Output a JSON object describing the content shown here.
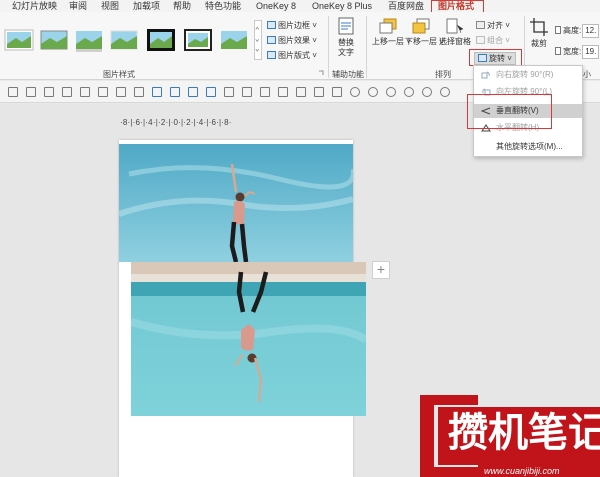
{
  "tabs": [
    "幻灯片放映",
    "审阅",
    "视图",
    "加载项",
    "帮助",
    "特色功能",
    "OneKey 8",
    "OneKey 8 Plus",
    "百度网盘",
    "图片格式"
  ],
  "active_tab": "图片格式",
  "ribbon": {
    "picture_styles_label": "图片样式",
    "picture_border": "图片边框",
    "picture_effects": "图片效果",
    "picture_layout": "图片版式",
    "alt_text": "替换\n文字",
    "accessibility_label": "辅助功能",
    "bring_forward": "上移一层",
    "send_backward": "下移一层",
    "selection_pane": "选择窗格",
    "align": "对齐",
    "group": "组合",
    "rotate": "旋转",
    "arrange_label": "排列",
    "crop": "裁剪",
    "height_label": "高度:",
    "height_value": "12.",
    "width_label": "宽度:",
    "width_value": "19.",
    "size_label_fragment": "小"
  },
  "rotate_menu": {
    "items": [
      {
        "label": "向右旋转 90°(R)",
        "enabled": false
      },
      {
        "label": "向左旋转 90°(L)",
        "enabled": false
      },
      {
        "label": "垂直翻转(V)",
        "enabled": true,
        "highlighted": true
      },
      {
        "label": "水平翻转(H)",
        "enabled": false
      },
      {
        "label": "其他旋转选项(M)...",
        "enabled": true
      }
    ]
  },
  "ruler_text": "·8·|·6·|·4·|·2·|·0·|·2·|·4·|·6·|·8·",
  "watermark": {
    "title": "攒机笔记",
    "url": "www.cuanjibiji.com"
  },
  "colors": {
    "accent_red": "#d9383a",
    "sky_top": "#5fb3cc",
    "water": "#7ccfd6"
  },
  "plus_symbol": "+"
}
